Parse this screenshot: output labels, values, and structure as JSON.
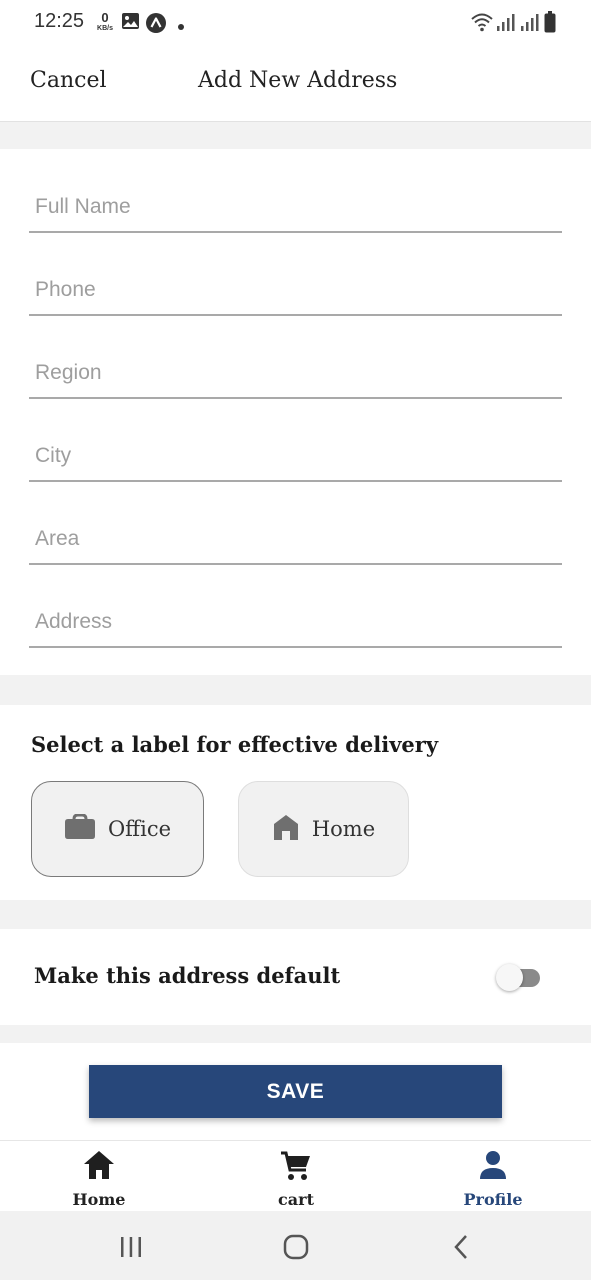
{
  "status_bar": {
    "time": "12:25",
    "net_speed_value": "0",
    "net_speed_unit": "KB/s",
    "icons": [
      "image-icon",
      "app-notification-icon",
      "dot-icon",
      "wifi-icon",
      "signal-icon",
      "signal-icon",
      "battery-icon"
    ]
  },
  "header": {
    "cancel_label": "Cancel",
    "title": "Add New Address"
  },
  "form": {
    "full_name": {
      "placeholder": "Full Name",
      "value": ""
    },
    "phone": {
      "placeholder": "Phone",
      "value": ""
    },
    "region": {
      "placeholder": "Region",
      "value": ""
    },
    "city": {
      "placeholder": "City",
      "value": ""
    },
    "area": {
      "placeholder": "Area",
      "value": ""
    },
    "address": {
      "placeholder": "Address",
      "value": ""
    }
  },
  "label_section": {
    "heading": "Select a label for effective delivery",
    "options": [
      {
        "label": "Office",
        "icon": "briefcase-icon",
        "selected": true
      },
      {
        "label": "Home",
        "icon": "home-icon",
        "selected": false
      }
    ]
  },
  "default_toggle": {
    "label": "Make this address default",
    "on": false
  },
  "save_label": "SAVE",
  "bottom_nav": {
    "items": [
      {
        "label": "Home",
        "icon": "home-icon",
        "active": false
      },
      {
        "label": "cart",
        "icon": "cart-icon",
        "active": false
      },
      {
        "label": "Profile",
        "icon": "person-icon",
        "active": true
      }
    ]
  },
  "colors": {
    "accent": "#27477a",
    "section_gap": "#f2f2f2",
    "chip_bg": "#f1f1f1"
  },
  "system_nav": [
    "recents-icon",
    "home-circle-icon",
    "back-icon"
  ]
}
